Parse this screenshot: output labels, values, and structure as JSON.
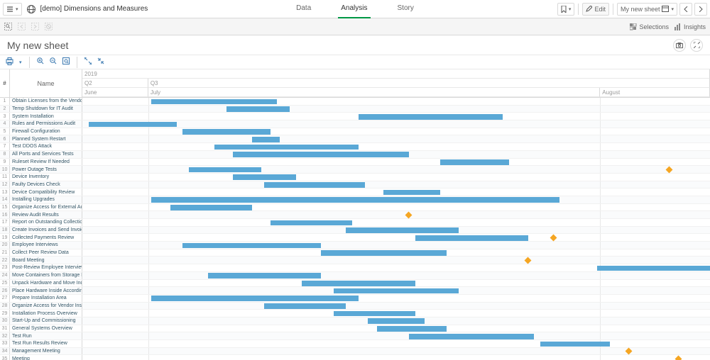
{
  "top": {
    "app_title": "[demo] Dimensions and Measures",
    "tabs": [
      "Data",
      "Analysis",
      "Story"
    ],
    "active_tab": 1,
    "edit_label": "Edit",
    "sheet_name": "My new sheet"
  },
  "toolbar2": {
    "selections_label": "Selections",
    "insights_label": "Insights"
  },
  "title": "My new sheet",
  "colors": {
    "bar": "#5aa8d6",
    "milestone": "#f5a623",
    "tab_underline": "#009845"
  },
  "chart_data": {
    "type": "gantt",
    "time_axis": {
      "year_row": [
        {
          "label": "2019",
          "start": 0,
          "span": 100
        }
      ],
      "quarter_row": [
        {
          "label": "Q2",
          "start": 0,
          "span": 10.5
        },
        {
          "label": "Q3",
          "start": 10.5,
          "span": 89.5
        }
      ],
      "month_row": [
        {
          "label": "June",
          "start": 0,
          "span": 10.5
        },
        {
          "label": "July",
          "start": 10.5,
          "span": 72
        },
        {
          "label": "August",
          "start": 82.5,
          "span": 17.5
        }
      ]
    },
    "columns": {
      "index": "#",
      "name": "Name"
    },
    "rows": [
      {
        "num": 1,
        "name": "Obtain Licenses from the Vendor",
        "bars": [
          {
            "start": 11,
            "len": 20
          }
        ]
      },
      {
        "num": 2,
        "name": "Temp Shutdown for IT Audit",
        "bars": [
          {
            "start": 23,
            "len": 10
          }
        ]
      },
      {
        "num": 3,
        "name": "System Installation",
        "bars": [
          {
            "start": 44,
            "len": 23
          }
        ]
      },
      {
        "num": 4,
        "name": "Rules and Permissions Audit",
        "bars": [
          {
            "start": 1,
            "len": 14
          }
        ]
      },
      {
        "num": 5,
        "name": "Firewall Configuration",
        "bars": [
          {
            "start": 16,
            "len": 14
          }
        ]
      },
      {
        "num": 6,
        "name": "Planned System Restart",
        "bars": [
          {
            "start": 27,
            "len": 4.5
          }
        ]
      },
      {
        "num": 7,
        "name": "Test DDOS Attack",
        "bars": [
          {
            "start": 21,
            "len": 23
          }
        ]
      },
      {
        "num": 8,
        "name": "All Ports and Services Tests",
        "bars": [
          {
            "start": 24,
            "len": 28
          }
        ]
      },
      {
        "num": 9,
        "name": "Ruleset Review If Needed",
        "bars": [
          {
            "start": 57,
            "len": 11
          }
        ]
      },
      {
        "num": 10,
        "name": "Power Outage Tests",
        "bars": [
          {
            "start": 17,
            "len": 11.5
          }
        ],
        "milestones": [
          {
            "pos": 93.5
          }
        ]
      },
      {
        "num": 11,
        "name": "Device Inventory",
        "bars": [
          {
            "start": 24,
            "len": 10
          }
        ]
      },
      {
        "num": 12,
        "name": "Faulty Devices Check",
        "bars": [
          {
            "start": 29,
            "len": 16
          }
        ]
      },
      {
        "num": 13,
        "name": "Device Compatibility Review",
        "bars": [
          {
            "start": 48,
            "len": 9
          }
        ]
      },
      {
        "num": 14,
        "name": "Installing Upgrades",
        "bars": [
          {
            "start": 11,
            "len": 65
          }
        ]
      },
      {
        "num": 15,
        "name": "Organize Access for External Audit Team",
        "bars": [
          {
            "start": 14,
            "len": 13
          }
        ]
      },
      {
        "num": 16,
        "name": "Review Audit Results",
        "bars": [],
        "milestones": [
          {
            "pos": 52
          }
        ]
      },
      {
        "num": 17,
        "name": "Report on Outstanding Collections",
        "bars": [
          {
            "start": 30,
            "len": 13
          }
        ]
      },
      {
        "num": 18,
        "name": "Create Invoices and Send Invoices",
        "bars": [
          {
            "start": 42,
            "len": 18
          }
        ]
      },
      {
        "num": 19,
        "name": "Collected Payments Review",
        "bars": [
          {
            "start": 53,
            "len": 18
          }
        ],
        "milestones": [
          {
            "pos": 75
          }
        ]
      },
      {
        "num": 20,
        "name": "Employee Interviews",
        "bars": [
          {
            "start": 16,
            "len": 22
          }
        ]
      },
      {
        "num": 21,
        "name": "Collect Peer Review Data",
        "bars": [
          {
            "start": 38,
            "len": 20
          }
        ]
      },
      {
        "num": 22,
        "name": "Board Meeting",
        "bars": [],
        "milestones": [
          {
            "pos": 71
          }
        ]
      },
      {
        "num": 23,
        "name": "Post-Review Employee Interviews and",
        "bars": [
          {
            "start": 82,
            "len": 18
          }
        ]
      },
      {
        "num": 24,
        "name": "Move Containers from Storage Facility",
        "bars": [
          {
            "start": 20,
            "len": 18
          }
        ]
      },
      {
        "num": 25,
        "name": "Unpack Hardware and Move Indoors",
        "bars": [
          {
            "start": 35,
            "len": 18
          }
        ]
      },
      {
        "num": 26,
        "name": "Place Hardware Inside According to Ins",
        "bars": [
          {
            "start": 40,
            "len": 20
          }
        ]
      },
      {
        "num": 27,
        "name": "Prepare Installation Area",
        "bars": [
          {
            "start": 11,
            "len": 33
          }
        ]
      },
      {
        "num": 28,
        "name": "Organize Access for Vendor Installation",
        "bars": [
          {
            "start": 29,
            "len": 13
          }
        ]
      },
      {
        "num": 29,
        "name": "Installation Process Overview",
        "bars": [
          {
            "start": 40,
            "len": 13
          }
        ]
      },
      {
        "num": 30,
        "name": "Start-Up and Commissioning",
        "bars": [
          {
            "start": 45.5,
            "len": 9
          }
        ]
      },
      {
        "num": 31,
        "name": "General Systems Overview",
        "bars": [
          {
            "start": 47,
            "len": 11
          }
        ]
      },
      {
        "num": 32,
        "name": "Test Run",
        "bars": [
          {
            "start": 52,
            "len": 20
          }
        ]
      },
      {
        "num": 33,
        "name": "Test Run Results Review",
        "bars": [
          {
            "start": 73,
            "len": 11
          }
        ]
      },
      {
        "num": 34,
        "name": "Management Meeting",
        "bars": [],
        "milestones": [
          {
            "pos": 87
          }
        ]
      },
      {
        "num": 35,
        "name": "Meeting",
        "bars": [],
        "milestones": [
          {
            "pos": 95
          }
        ]
      }
    ]
  }
}
